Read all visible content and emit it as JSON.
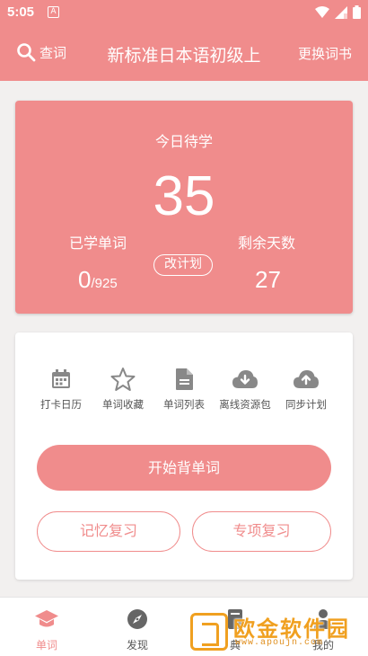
{
  "status_bar": {
    "time": "5:05",
    "notification_icon": "A"
  },
  "app_bar": {
    "search_label": "查词",
    "title": "新标准日本语初级上",
    "change_book_label": "更换词书"
  },
  "stats": {
    "today_label": "今日待学",
    "today_count": "35",
    "learned_label": "已学单词",
    "learned_count": "0",
    "learned_total": "/925",
    "remaining_label": "剩余天数",
    "remaining_days": "27",
    "change_plan_label": "改计划"
  },
  "features": [
    {
      "label": "打卡日历",
      "icon": "calendar-icon"
    },
    {
      "label": "单词收藏",
      "icon": "star-icon"
    },
    {
      "label": "单词列表",
      "icon": "document-icon"
    },
    {
      "label": "离线资源包",
      "icon": "cloud-download-icon"
    },
    {
      "label": "同步计划",
      "icon": "cloud-upload-icon"
    }
  ],
  "actions": {
    "start_label": "开始背单词",
    "memory_review_label": "记忆复习",
    "special_review_label": "专项复习"
  },
  "bottom_nav": [
    {
      "label": "单词",
      "icon": "graduation-cap-icon",
      "active": true
    },
    {
      "label": "发现",
      "icon": "compass-icon",
      "active": false
    },
    {
      "label": "典",
      "icon": "book-icon",
      "active": false
    },
    {
      "label": "我的",
      "icon": "person-icon",
      "active": false
    }
  ],
  "watermark": {
    "text": "欧金软件园",
    "url": "www.apoujn.com"
  },
  "colors": {
    "accent": "#f08c8c",
    "background": "#f2f0ef",
    "watermark": "#f0a020"
  }
}
